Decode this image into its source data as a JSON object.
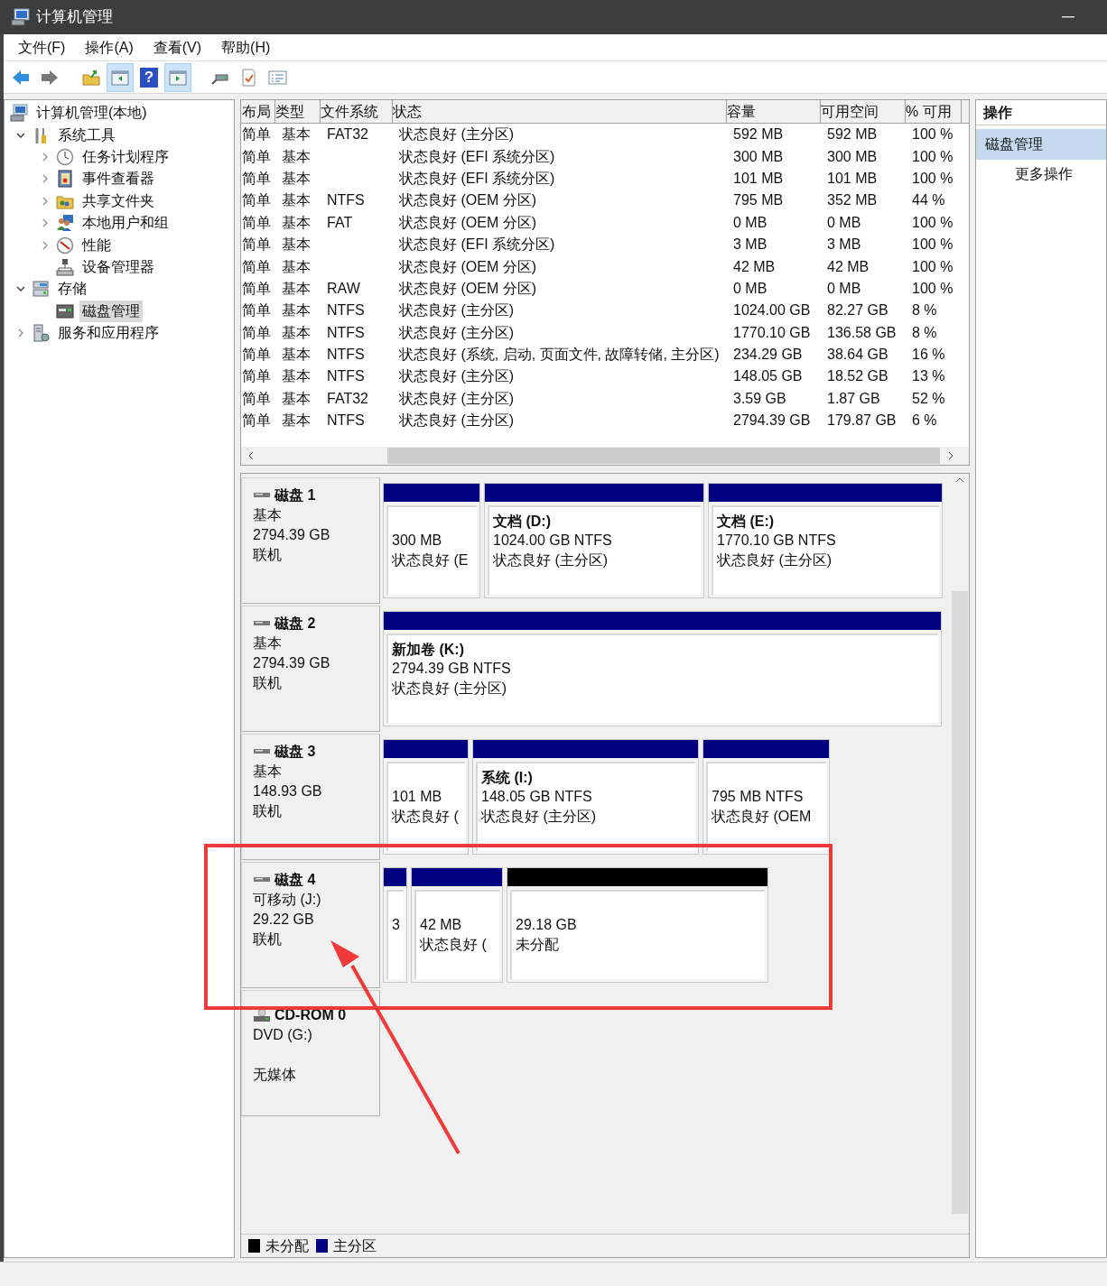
{
  "window": {
    "title": "计算机管理"
  },
  "menu": [
    "文件(F)",
    "操作(A)",
    "查看(V)",
    "帮助(H)"
  ],
  "toolbar": [
    {
      "kind": "back",
      "pressed": false
    },
    {
      "kind": "forward",
      "pressed": false
    },
    {
      "kind": "up",
      "pressed": false
    },
    {
      "kind": "tree",
      "pressed": true
    },
    {
      "kind": "help",
      "pressed": false,
      "glyph": "?"
    },
    {
      "kind": "actions",
      "pressed": true
    },
    {
      "kind": "connect",
      "pressed": false
    },
    {
      "kind": "properties",
      "pressed": false
    },
    {
      "kind": "list",
      "pressed": false
    }
  ],
  "tree": [
    {
      "label": "计算机管理(本地)",
      "selected": false,
      "children": [
        {
          "label": "系统工具",
          "selected": false,
          "expanded": true,
          "children": [
            {
              "label": "任务计划程序",
              "selected": false,
              "expanded": false
            },
            {
              "label": "事件查看器",
              "selected": false,
              "expanded": false
            },
            {
              "label": "共享文件夹",
              "selected": false,
              "expanded": false
            },
            {
              "label": "本地用户和组",
              "selected": false,
              "expanded": false
            },
            {
              "label": "性能",
              "selected": false,
              "expanded": false
            },
            {
              "label": "设备管理器",
              "selected": false
            }
          ]
        },
        {
          "label": "存储",
          "selected": false,
          "expanded": true,
          "children": [
            {
              "label": "磁盘管理",
              "selected": true
            }
          ]
        },
        {
          "label": "服务和应用程序",
          "selected": false,
          "expanded": false
        }
      ]
    }
  ],
  "table": {
    "columns": [
      "布局",
      "类型",
      "文件系统",
      "状态",
      "容量",
      "可用空间",
      "% 可用"
    ],
    "rows": [
      {
        "layout": "简单",
        "type": "基本",
        "file_system": "FAT32",
        "status": "状态良好 (主分区)",
        "capacity": "592 MB",
        "free_space": "592 MB",
        "percent_free": "100 %"
      },
      {
        "layout": "简单",
        "type": "基本",
        "status": "状态良好 (EFI 系统分区)",
        "capacity": "300 MB",
        "free_space": "300 MB",
        "percent_free": "100 %"
      },
      {
        "layout": "简单",
        "type": "基本",
        "status": "状态良好 (EFI 系统分区)",
        "capacity": "101 MB",
        "free_space": "101 MB",
        "percent_free": "100 %"
      },
      {
        "layout": "简单",
        "type": "基本",
        "file_system": "NTFS",
        "status": "状态良好 (OEM 分区)",
        "capacity": "795 MB",
        "free_space": "352 MB",
        "percent_free": "44 %"
      },
      {
        "layout": "简单",
        "type": "基本",
        "file_system": "FAT",
        "status": "状态良好 (OEM 分区)",
        "capacity": "0 MB",
        "free_space": "0 MB",
        "percent_free": "100 %"
      },
      {
        "layout": "简单",
        "type": "基本",
        "status": "状态良好 (EFI 系统分区)",
        "capacity": "3 MB",
        "free_space": "3 MB",
        "percent_free": "100 %"
      },
      {
        "layout": "简单",
        "type": "基本",
        "status": "状态良好 (OEM 分区)",
        "capacity": "42 MB",
        "free_space": "42 MB",
        "percent_free": "100 %"
      },
      {
        "layout": "简单",
        "type": "基本",
        "file_system": "RAW",
        "status": "状态良好 (OEM 分区)",
        "capacity": "0 MB",
        "free_space": "0 MB",
        "percent_free": "100 %"
      },
      {
        "layout": "简单",
        "type": "基本",
        "file_system": "NTFS",
        "status": "状态良好 (主分区)",
        "capacity": "1024.00 GB",
        "free_space": "82.27 GB",
        "percent_free": "8 %"
      },
      {
        "layout": "简单",
        "type": "基本",
        "file_system": "NTFS",
        "status": "状态良好 (主分区)",
        "capacity": "1770.10 GB",
        "free_space": "136.58 GB",
        "percent_free": "8 %"
      },
      {
        "layout": "简单",
        "type": "基本",
        "file_system": "NTFS",
        "status": "状态良好 (系统, 启动, 页面文件, 故障转储, 主分区)",
        "capacity": "234.29 GB",
        "free_space": "38.64 GB",
        "percent_free": "16 %"
      },
      {
        "layout": "简单",
        "type": "基本",
        "file_system": "NTFS",
        "status": "状态良好 (主分区)",
        "capacity": "148.05 GB",
        "free_space": "18.52 GB",
        "percent_free": "13 %"
      },
      {
        "layout": "简单",
        "type": "基本",
        "file_system": "FAT32",
        "status": "状态良好 (主分区)",
        "capacity": "3.59 GB",
        "free_space": "1.87 GB",
        "percent_free": "52 %"
      },
      {
        "layout": "简单",
        "type": "基本",
        "file_system": "NTFS",
        "status": "状态良好 (主分区)",
        "capacity": "2794.39 GB",
        "free_space": "179.87 GB",
        "percent_free": "6 %"
      }
    ]
  },
  "disks": [
    {
      "kind": "disk",
      "name": "磁盘 1",
      "type": "基本",
      "size": "2794.39 GB",
      "state": "联机",
      "partitions": [
        {
          "kind": "primary",
          "lines": [
            "300 MB",
            "状态良好 (E"
          ]
        },
        {
          "kind": "primary",
          "title": "文档  (D:)",
          "lines": [
            "1024.00 GB NTFS",
            "状态良好 (主分区)"
          ]
        },
        {
          "kind": "primary",
          "title": "文档  (E:)",
          "lines": [
            "1770.10 GB NTFS",
            "状态良好 (主分区)"
          ]
        }
      ]
    },
    {
      "kind": "disk",
      "name": "磁盘 2",
      "type": "基本",
      "size": "2794.39 GB",
      "state": "联机",
      "partitions": [
        {
          "kind": "primary",
          "title": "新加卷  (K:)",
          "lines": [
            "2794.39 GB NTFS",
            "状态良好 (主分区)"
          ]
        }
      ]
    },
    {
      "kind": "disk",
      "name": "磁盘 3",
      "type": "基本",
      "size": "148.93 GB",
      "state": "联机",
      "partitions": [
        {
          "kind": "primary",
          "lines": [
            "101 MB",
            "状态良好 ("
          ]
        },
        {
          "kind": "primary",
          "title": "系统  (I:)",
          "lines": [
            "148.05 GB NTFS",
            "状态良好 (主分区)"
          ]
        },
        {
          "kind": "primary",
          "lines": [
            "795 MB NTFS",
            "状态良好 (OEM"
          ]
        }
      ]
    },
    {
      "kind": "disk",
      "name": "磁盘 4",
      "type": "可移动 (J:)",
      "size": "29.22 GB",
      "state": "联机",
      "partitions": [
        {
          "kind": "primary",
          "lines": [
            "3"
          ]
        },
        {
          "kind": "primary",
          "lines": [
            "42 MB",
            "状态良好 ("
          ]
        },
        {
          "kind": "unallocated",
          "lines": [
            "29.18 GB",
            "未分配"
          ]
        }
      ]
    },
    {
      "kind": "cdrom",
      "name": "CD-ROM 0",
      "type": "DVD (G:)",
      "state": "无媒体"
    }
  ],
  "legend": [
    {
      "label": "未分配",
      "color": "#000000"
    },
    {
      "label": "主分区",
      "color": "#000080"
    }
  ],
  "actions": {
    "header": "操作",
    "section": "磁盘管理",
    "items": [
      "更多操作"
    ]
  }
}
